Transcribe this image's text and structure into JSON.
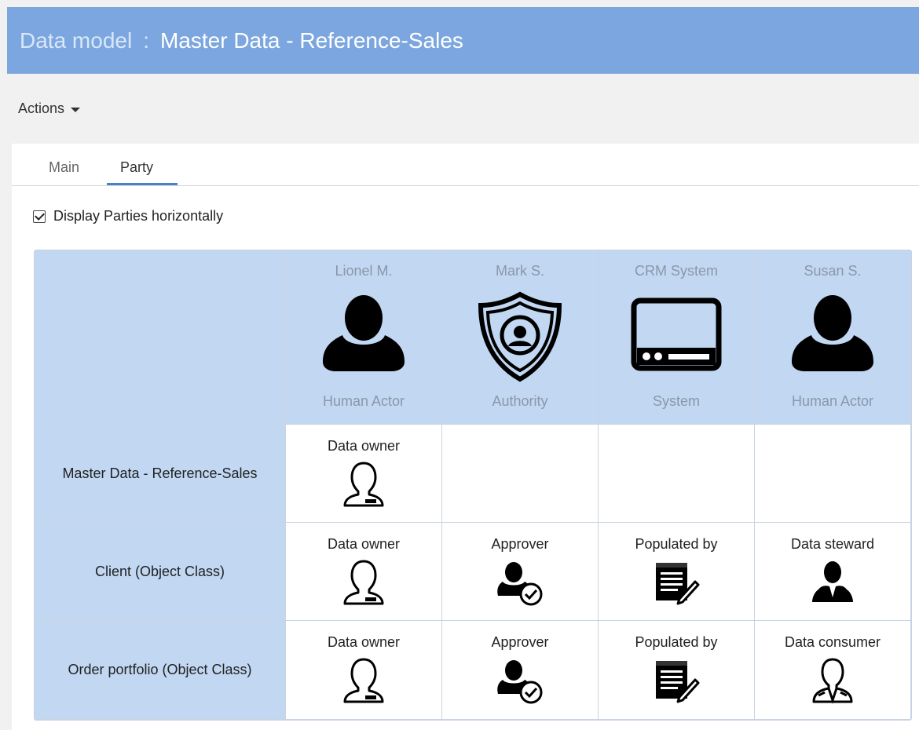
{
  "header": {
    "label": "Data model",
    "separator": ":",
    "name": "Master Data - Reference-Sales"
  },
  "toolbar": {
    "actions_label": "Actions"
  },
  "tabs": [
    {
      "label": "Main"
    },
    {
      "label": "Party"
    }
  ],
  "options": {
    "display_horizontal_label": "Display Parties horizontally"
  },
  "parties": [
    {
      "name": "Lionel M.",
      "type": "Human Actor",
      "icon": "person-icon"
    },
    {
      "name": "Mark S.",
      "type": "Authority",
      "icon": "shield-person-icon"
    },
    {
      "name": "CRM System",
      "type": "System",
      "icon": "system-device-icon"
    },
    {
      "name": "Susan S.",
      "type": "Human Actor",
      "icon": "person-icon"
    }
  ],
  "rows": [
    {
      "label": "Master Data - Reference-Sales",
      "roles": [
        {
          "label": "Data owner",
          "icon": "data-owner-icon"
        },
        null,
        null,
        null
      ]
    },
    {
      "label": "Client (Object Class)",
      "roles": [
        {
          "label": "Data owner",
          "icon": "data-owner-icon"
        },
        {
          "label": "Approver",
          "icon": "approver-icon"
        },
        {
          "label": "Populated by",
          "icon": "populated-by-icon"
        },
        {
          "label": "Data steward",
          "icon": "data-steward-icon"
        }
      ]
    },
    {
      "label": "Order portfolio (Object Class)",
      "roles": [
        {
          "label": "Data owner",
          "icon": "data-owner-icon"
        },
        {
          "label": "Approver",
          "icon": "approver-icon"
        },
        {
          "label": "Populated by",
          "icon": "populated-by-icon"
        },
        {
          "label": "Data consumer",
          "icon": "data-consumer-icon"
        }
      ]
    }
  ],
  "colors": {
    "header_bg": "#7ba6df",
    "grid_header_bg": "#c1d7f2",
    "tab_accent": "#4a7fcb"
  }
}
